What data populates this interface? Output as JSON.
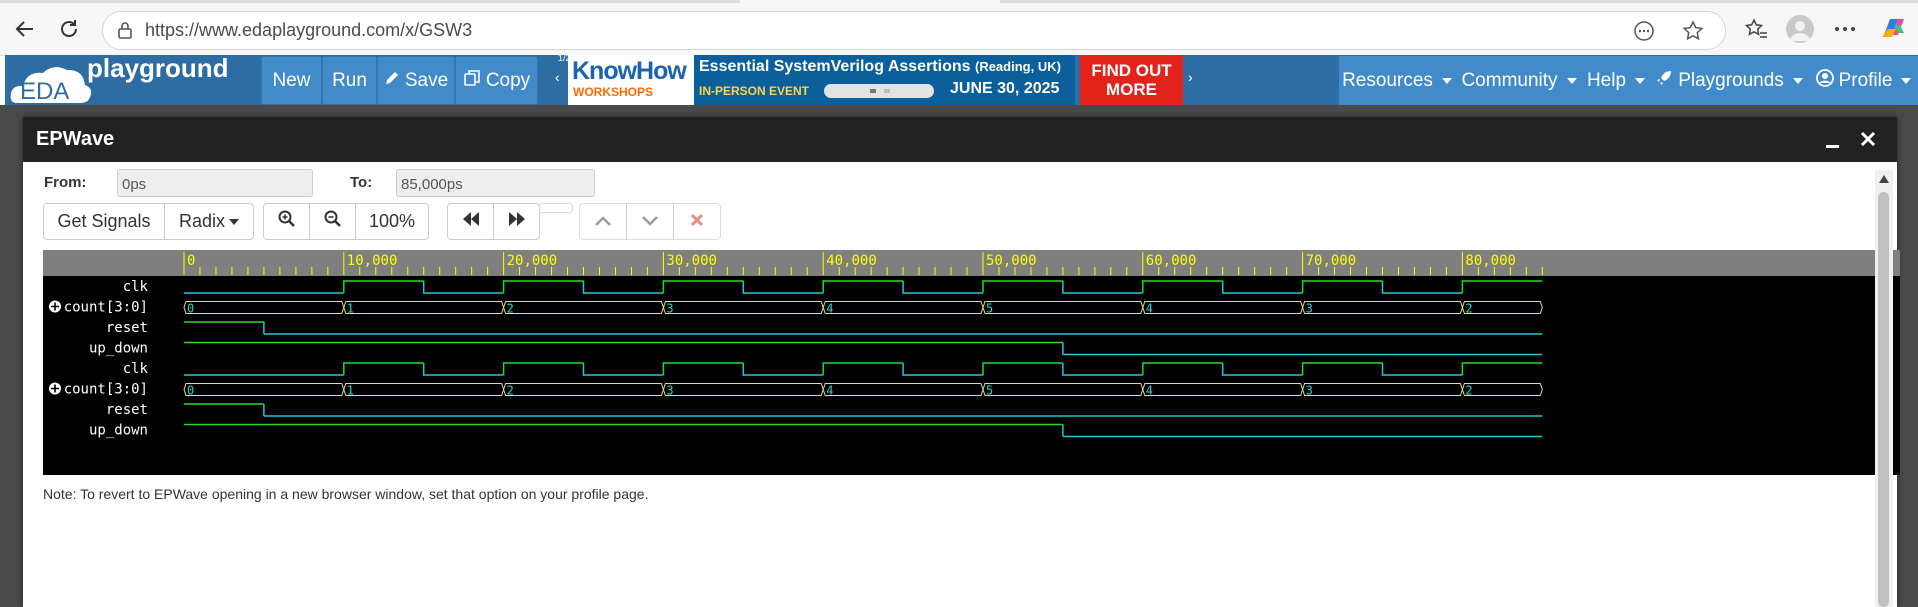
{
  "browser": {
    "url": "https://www.edaplayground.com/x/GSW3"
  },
  "site_nav": {
    "logo_text": "EDA",
    "logo_word": "playground",
    "buttons": [
      {
        "label": "New",
        "icon": "none"
      },
      {
        "label": "Run",
        "icon": "none"
      },
      {
        "label": "Save",
        "icon": "pencil-icon"
      },
      {
        "label": "Copy",
        "icon": "copy-icon"
      }
    ],
    "ad_pager": "1/2",
    "ad": {
      "brand_top": "KnowHow",
      "brand_bottom": "WORKSHOPS",
      "headline": "Essential SystemVerilog Assertions",
      "headline_suffix": "(Reading, UK)",
      "event_type": "IN-PERSON EVENT",
      "date": "JUNE 30, 2025",
      "cta_line1": "FIND OUT",
      "cta_line2": "MORE"
    },
    "menus": [
      {
        "label": "Resources"
      },
      {
        "label": "Community"
      },
      {
        "label": "Help"
      },
      {
        "label": "Playgrounds",
        "icon": "rocket-icon"
      },
      {
        "label": "Profile",
        "icon": "user-icon"
      }
    ]
  },
  "modal": {
    "title": "EPWave",
    "from_label": "From:",
    "from_value": "0ps",
    "to_label": "To:",
    "to_value": "85,000ps",
    "toolbar": {
      "get_signals": "Get Signals",
      "radix": "Radix",
      "zoom": "100%"
    },
    "note": "Note: To revert to EPWave opening in a new browser window, set that option on your profile page."
  },
  "wave": {
    "time_end_ps": 85000,
    "ticks": [
      "0",
      "10,000",
      "20,000",
      "30,000",
      "40,000",
      "50,000",
      "60,000",
      "70,000",
      "80,000"
    ],
    "signals": [
      {
        "name": "clk",
        "type": "clock",
        "expandable": false
      },
      {
        "name": "count[3:0]",
        "type": "bus",
        "expandable": true
      },
      {
        "name": "reset",
        "type": "bit",
        "expandable": false
      },
      {
        "name": "up_down",
        "type": "bit",
        "expandable": false
      },
      {
        "name": "clk",
        "type": "clock",
        "expandable": false
      },
      {
        "name": "count[3:0]",
        "type": "bus",
        "expandable": true
      },
      {
        "name": "reset",
        "type": "bit",
        "expandable": false
      },
      {
        "name": "up_down",
        "type": "bit",
        "expandable": false
      }
    ],
    "clk_period_ps": 10000,
    "clk_first_rise_ps": 10000,
    "count_values": [
      {
        "t": 0,
        "v": "0"
      },
      {
        "t": 10000,
        "v": "1"
      },
      {
        "t": 20000,
        "v": "2"
      },
      {
        "t": 30000,
        "v": "3"
      },
      {
        "t": 40000,
        "v": "4"
      },
      {
        "t": 50000,
        "v": "5"
      },
      {
        "t": 60000,
        "v": "4"
      },
      {
        "t": 70000,
        "v": "3"
      },
      {
        "t": 80000,
        "v": "2"
      }
    ],
    "reset_edges": [
      {
        "t": 0,
        "v": 1
      },
      {
        "t": 5000,
        "v": 0
      }
    ],
    "up_down_edges": [
      {
        "t": 0,
        "v": 1
      },
      {
        "t": 55000,
        "v": 0
      }
    ],
    "colors": {
      "high": "#22dd22",
      "low": "#22c7d8",
      "bus": "#dddd99",
      "ruler_text": "#ffff00"
    }
  }
}
